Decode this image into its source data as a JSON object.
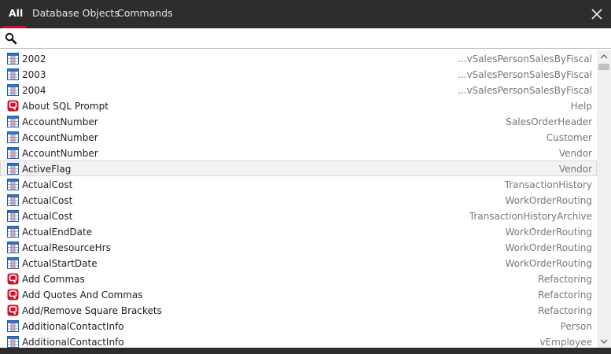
{
  "tabs": [
    {
      "label": "All",
      "active": true
    },
    {
      "label": "Database Objects",
      "active": false
    },
    {
      "label": "Commands",
      "active": false
    }
  ],
  "accent_color": "#c8102e",
  "search": {
    "value": "",
    "placeholder": ""
  },
  "icon_names": {
    "column": "table-column-icon",
    "command": "sql-prompt-command-icon",
    "search": "search-icon",
    "close": "close-icon"
  },
  "results": [
    {
      "label": "2002",
      "source": "...vSalesPersonSalesByFiscal",
      "icon": "column"
    },
    {
      "label": "2003",
      "source": "...vSalesPersonSalesByFiscal",
      "icon": "column"
    },
    {
      "label": "2004",
      "source": "...vSalesPersonSalesByFiscal",
      "icon": "column"
    },
    {
      "label": "About SQL Prompt",
      "source": "Help",
      "icon": "command"
    },
    {
      "label": "AccountNumber",
      "source": "SalesOrderHeader",
      "icon": "column"
    },
    {
      "label": "AccountNumber",
      "source": "Customer",
      "icon": "column"
    },
    {
      "label": "AccountNumber",
      "source": "Vendor",
      "icon": "column"
    },
    {
      "label": "ActiveFlag",
      "source": "Vendor",
      "icon": "column",
      "selected": true
    },
    {
      "label": "ActualCost",
      "source": "TransactionHistory",
      "icon": "column"
    },
    {
      "label": "ActualCost",
      "source": "WorkOrderRouting",
      "icon": "column"
    },
    {
      "label": "ActualCost",
      "source": "TransactionHistoryArchive",
      "icon": "column"
    },
    {
      "label": "ActualEndDate",
      "source": "WorkOrderRouting",
      "icon": "column"
    },
    {
      "label": "ActualResourceHrs",
      "source": "WorkOrderRouting",
      "icon": "column"
    },
    {
      "label": "ActualStartDate",
      "source": "WorkOrderRouting",
      "icon": "column"
    },
    {
      "label": "Add Commas",
      "source": "Refactoring",
      "icon": "command"
    },
    {
      "label": "Add Quotes And Commas",
      "source": "Refactoring",
      "icon": "command"
    },
    {
      "label": "Add/Remove Square Brackets",
      "source": "Refactoring",
      "icon": "command"
    },
    {
      "label": "AdditionalContactInfo",
      "source": "Person",
      "icon": "column"
    },
    {
      "label": "AdditionalContactInfo",
      "source": "vEmployee",
      "icon": "column"
    }
  ]
}
